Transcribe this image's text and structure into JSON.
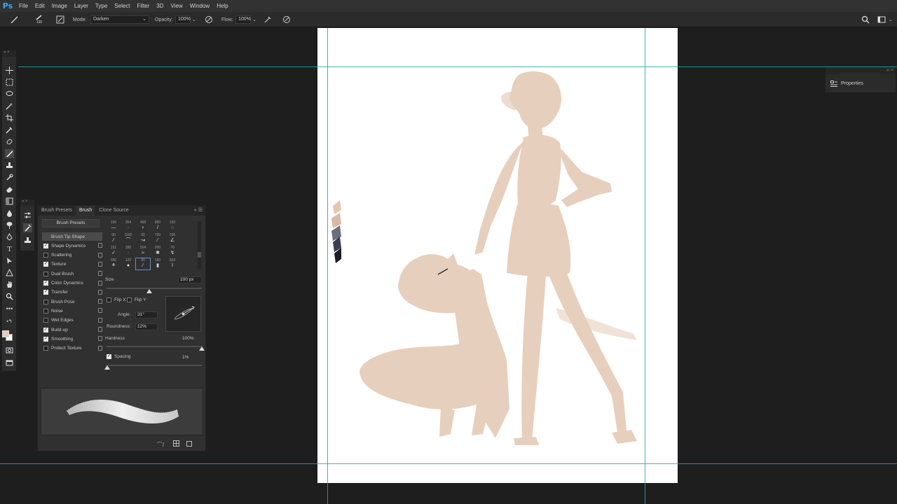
{
  "app": {
    "logo": "Ps"
  },
  "menu": [
    "File",
    "Edit",
    "Image",
    "Layer",
    "Type",
    "Select",
    "Filter",
    "3D",
    "View",
    "Window",
    "Help"
  ],
  "options": {
    "brush_size": "100",
    "mode_label": "Mode:",
    "mode_value": "Darken",
    "opacity_label": "Opacity:",
    "opacity_value": "100%",
    "flow_label": "Flow:",
    "flow_value": "100%"
  },
  "brush_panel": {
    "tabs": [
      "Brush Presets",
      "Brush",
      "Clone Source"
    ],
    "active_tab": "Brush",
    "presets_button": "Brush Presets",
    "options": [
      {
        "label": "Brush Tip Shape",
        "checkbox": false,
        "checked": false,
        "selected": true
      },
      {
        "label": "Shape Dynamics",
        "checkbox": true,
        "checked": true
      },
      {
        "label": "Scattering",
        "checkbox": true,
        "checked": false
      },
      {
        "label": "Texture",
        "checkbox": true,
        "checked": true
      },
      {
        "label": "Dual Brush",
        "checkbox": true,
        "checked": false
      },
      {
        "label": "Color Dynamics",
        "checkbox": true,
        "checked": true
      },
      {
        "label": "Transfer",
        "checkbox": true,
        "checked": true
      },
      {
        "label": "Brush Pose",
        "checkbox": true,
        "checked": false
      },
      {
        "label": "Noise",
        "checkbox": true,
        "checked": false
      },
      {
        "label": "Wet Edges",
        "checkbox": true,
        "checked": false
      },
      {
        "label": "Build-up",
        "checkbox": true,
        "checked": true
      },
      {
        "label": "Smoothing",
        "checkbox": true,
        "checked": true
      },
      {
        "label": "Protect Texture",
        "checkbox": true,
        "checked": false
      }
    ],
    "tip_sizes": [
      [
        "150",
        "354",
        "468",
        "890",
        "150"
      ],
      [
        "90",
        "1100",
        "90",
        "700",
        "200"
      ],
      [
        "151",
        "390",
        "504",
        "200",
        "70"
      ],
      [
        "300",
        "125",
        "90",
        "150",
        "603"
      ]
    ],
    "size_label": "Size",
    "size_value": "100 px",
    "flip_x": "Flip X",
    "flip_y": "Flip Y",
    "angle_label": "Angle:",
    "angle_value": "31°",
    "roundness_label": "Roundness:",
    "roundness_value": "12%",
    "hardness_label": "Hardness",
    "hardness_value": "100%",
    "hardness_level": 1.0,
    "spacing_label": "Spacing",
    "spacing_value": "1%",
    "spacing_level": 0.01,
    "size_level": 0.45
  },
  "properties_panel": {
    "title": "Properties"
  },
  "colors": {
    "foreground": "#e6cbb7",
    "background": "#ffffff",
    "guide": "#26a2b0",
    "figure": "#e3c7b2",
    "accent": "#31a8ff"
  }
}
